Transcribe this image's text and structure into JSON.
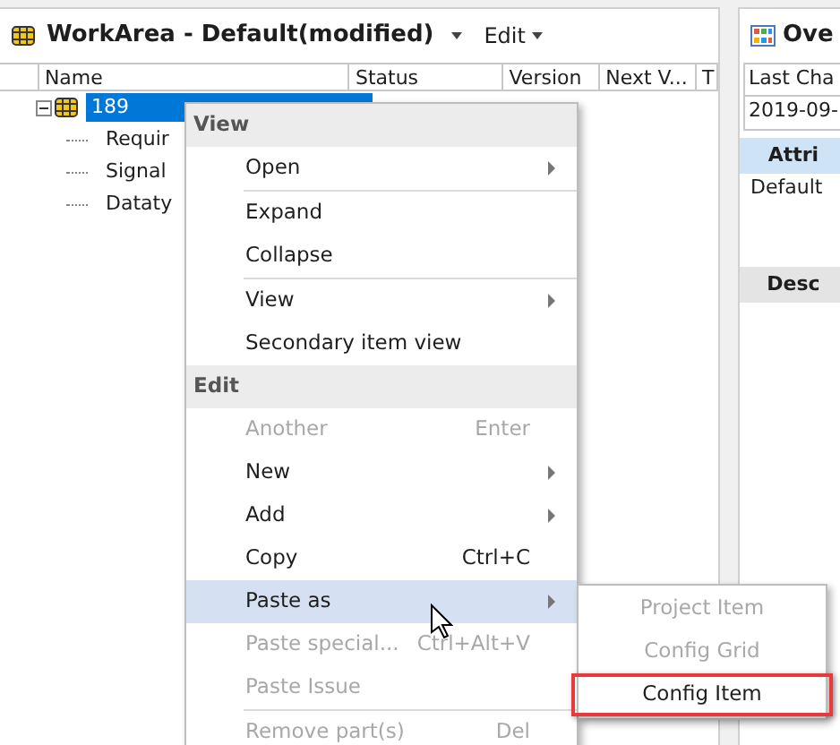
{
  "workarea": {
    "title": "WorkArea - Default(modified)",
    "edit_menu": "Edit",
    "columns": [
      "Name",
      "Status",
      "Version",
      "Next V...",
      "T"
    ],
    "rows": [
      {
        "name": "189",
        "selected": true,
        "expanded": true,
        "children": [
          {
            "name": "Requir",
            "selected": false
          },
          {
            "name": "Signal",
            "selected": false
          },
          {
            "name": "Dataty",
            "selected": false
          }
        ]
      }
    ]
  },
  "overview": {
    "title": "Ove",
    "table_header": "Last Cha",
    "table_value": "2019-09-",
    "sections": [
      {
        "title": "Attri",
        "active": true,
        "rows": [
          "Default"
        ]
      },
      {
        "title": "Desc",
        "active": false
      }
    ]
  },
  "context_menu": {
    "items": [
      {
        "kind": "header",
        "label": "View"
      },
      {
        "kind": "item",
        "label": "Open",
        "submenu": true,
        "disabled": false,
        "selected": false,
        "separator": true
      },
      {
        "kind": "item",
        "label": "Expand",
        "disabled": false,
        "selected": false
      },
      {
        "kind": "item",
        "label": "Collapse",
        "disabled": false,
        "selected": false,
        "separator": true
      },
      {
        "kind": "item",
        "label": "View",
        "submenu": true,
        "disabled": false,
        "selected": false
      },
      {
        "kind": "item",
        "label": "Secondary item view",
        "disabled": false,
        "selected": false
      },
      {
        "kind": "header",
        "label": "Edit"
      },
      {
        "kind": "item",
        "label": "Another",
        "shortcut": "Enter",
        "disabled": true,
        "selected": false
      },
      {
        "kind": "item",
        "label": "New",
        "submenu": true,
        "disabled": false,
        "selected": false
      },
      {
        "kind": "item",
        "label": "Add",
        "submenu": true,
        "disabled": false,
        "selected": false
      },
      {
        "kind": "item",
        "label": "Copy",
        "shortcut": "Ctrl+C",
        "disabled": false,
        "selected": false
      },
      {
        "kind": "item",
        "label": "Paste as",
        "submenu": true,
        "disabled": false,
        "selected": true
      },
      {
        "kind": "item",
        "label": "Paste special...",
        "shortcut": "Ctrl+Alt+V",
        "disabled": true,
        "selected": false
      },
      {
        "kind": "item",
        "label": "Paste Issue",
        "disabled": true,
        "selected": false,
        "separator": true
      },
      {
        "kind": "item",
        "label": "Remove part(s)",
        "shortcut": "Del",
        "disabled": true,
        "selected": false
      }
    ]
  },
  "submenu": {
    "items": [
      {
        "label": "Project Item",
        "disabled": true,
        "highlighted": false
      },
      {
        "label": "Config Grid",
        "disabled": true,
        "highlighted": false
      },
      {
        "label": "Config Item",
        "disabled": false,
        "highlighted": true
      }
    ]
  }
}
